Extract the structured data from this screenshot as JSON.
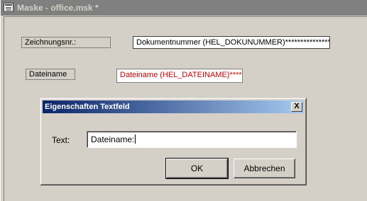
{
  "window": {
    "title": "Maske - office.msk *"
  },
  "form": {
    "fields": [
      {
        "label": "Zeichnungsnr.:",
        "value": "Dokumentnummer (HEL_DOKUNUMMER)******************",
        "color": "#000000"
      },
      {
        "label": "Dateiname",
        "value": "Dateiname (HEL_DATEINAME)*******",
        "color": "#cc0000"
      }
    ]
  },
  "dialog": {
    "title": "Eigenschaften Textfeld",
    "close_glyph": "X",
    "text_label": "Text:",
    "text_value": "Dateiname:",
    "ok_label": "OK",
    "cancel_label": "Abbrechen"
  }
}
